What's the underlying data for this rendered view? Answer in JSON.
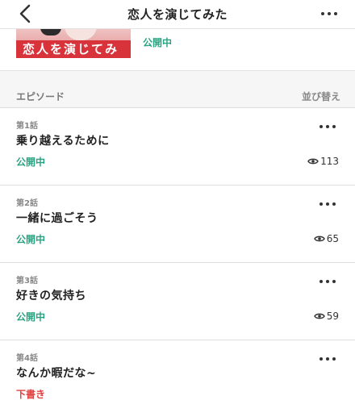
{
  "header": {
    "title": "恋人を演じてみた",
    "back_icon": "chevron-left-icon",
    "more_icon": "more-horizontal-icon"
  },
  "work": {
    "thumbnail_text": "恋人を演じてみた",
    "status": "公開中"
  },
  "episodes_section": {
    "title": "エピソード",
    "sort_label": "並び替え"
  },
  "episodes": [
    {
      "number": "第1話",
      "title": "乗り越えるために",
      "status": "公開中",
      "status_type": "published",
      "views": "113"
    },
    {
      "number": "第2話",
      "title": "一緒に過ごそう",
      "status": "公開中",
      "status_type": "published",
      "views": "65"
    },
    {
      "number": "第3話",
      "title": "好きの気持ち",
      "status": "公開中",
      "status_type": "published",
      "views": "59"
    },
    {
      "number": "第4話",
      "title": "なんか暇だな~",
      "status": "下書き",
      "status_type": "draft",
      "views": ""
    }
  ],
  "colors": {
    "published": "#2aa382",
    "draft": "#e04141"
  }
}
